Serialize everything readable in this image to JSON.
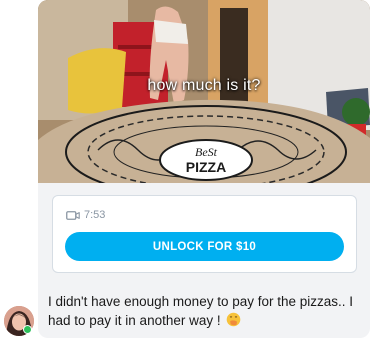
{
  "post": {
    "caption": "how much is it?",
    "box_print": {
      "brand": "BeSt",
      "word": "PIZZA"
    },
    "video_duration": "7:53",
    "unlock_label": "UNLOCK FOR $10",
    "message_text": "I didn't have enough money to pay for the pizzas.. I had to pay it in another way !",
    "emoji": "face-with-hand-over-mouth-icon"
  },
  "colors": {
    "accent": "#00aff0",
    "online": "#2ec05c",
    "meta_text": "#8a96a3"
  }
}
